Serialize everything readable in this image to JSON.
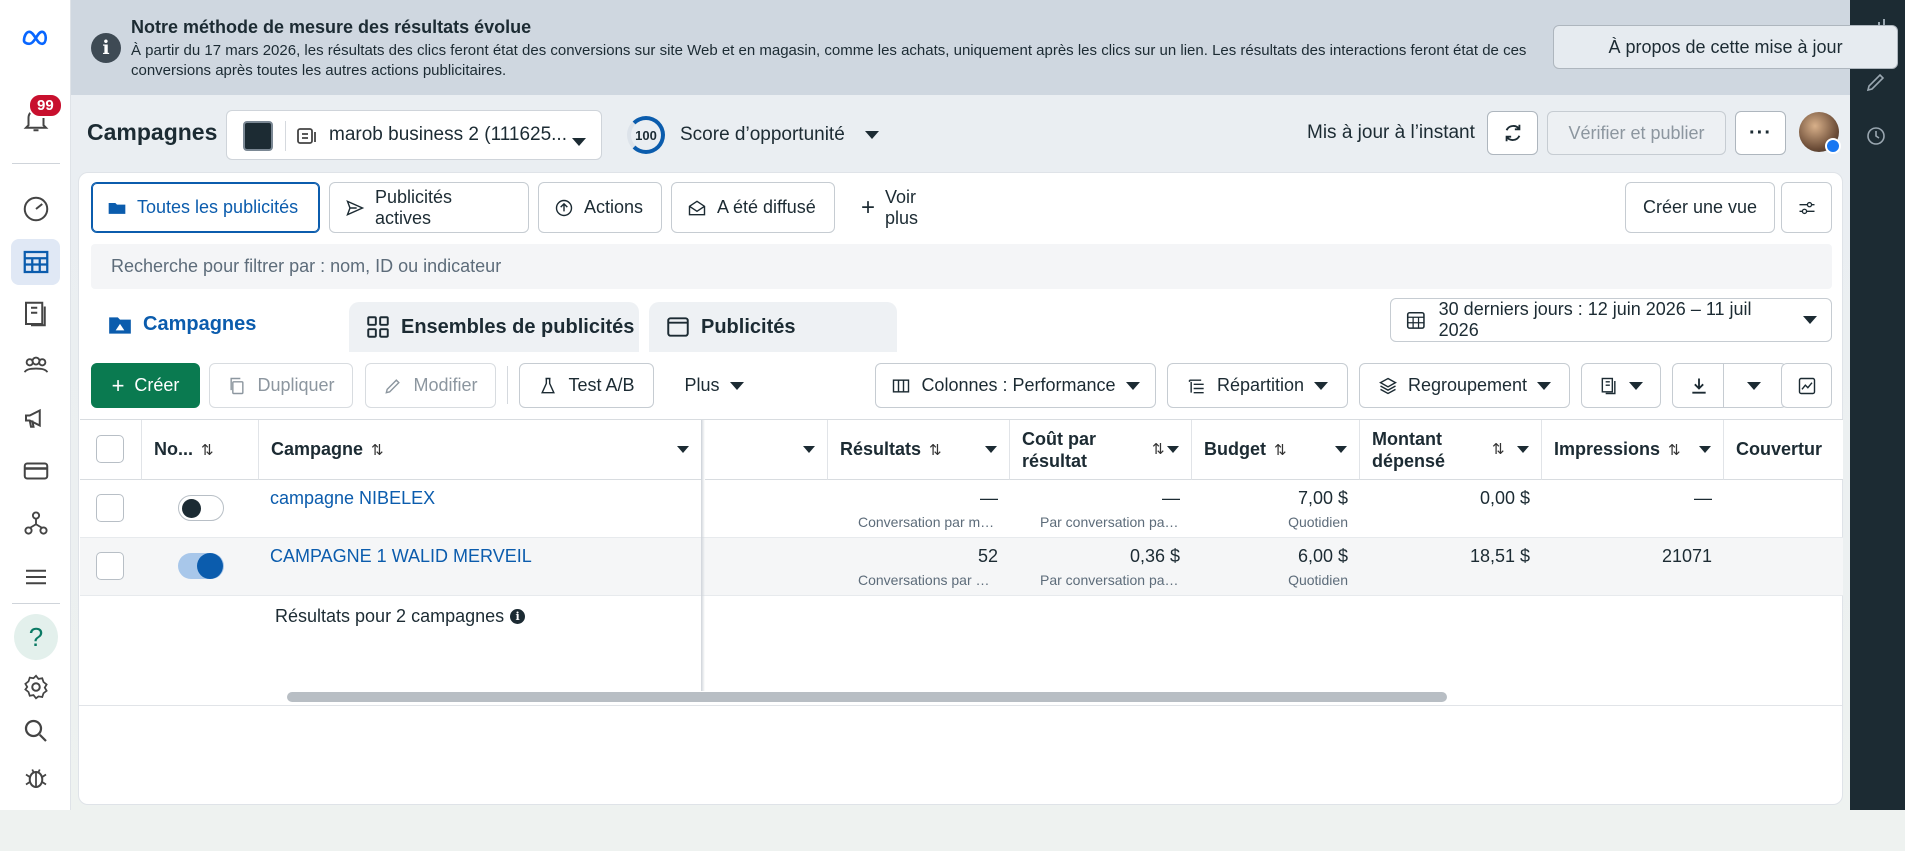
{
  "banner": {
    "title": "Notre méthode de mesure des résultats évolue",
    "text": "À partir du 17 mars 2026, les résultats des clics feront état des conversions sur site Web et en magasin, comme les achats, uniquement après les clics sur un lien. Les résultats des interactions feront état de ces conversions après toutes les autres actions publicitaires.",
    "button": "À propos de cette mise à jour"
  },
  "nav": {
    "notifications": "99"
  },
  "header": {
    "title": "Campagnes",
    "account": "marob business 2 (111625...",
    "score_value": "100",
    "score_label": "Score d’opportunité",
    "updated": "Mis à jour à l’instant",
    "publish": "Vérifier et publier",
    "more": "···"
  },
  "views": {
    "all": "Toutes les publicités",
    "active": "Publicités actives",
    "actions": "Actions",
    "delivered": "A été diffusé",
    "more": "Voir plus",
    "create_view": "Créer une vue"
  },
  "search": {
    "placeholder": "Recherche pour filtrer par : nom, ID ou indicateur"
  },
  "tabs": {
    "campaigns": "Campagnes",
    "adsets": "Ensembles de publicités",
    "ads": "Publicités"
  },
  "date_range": "30 derniers jours : 12 juin 2026 – 11 juil 2026",
  "toolbar": {
    "create": "Créer",
    "duplicate": "Dupliquer",
    "edit": "Modifier",
    "ab_test": "Test A/B",
    "more": "Plus",
    "columns": "Colonnes : Performance",
    "breakdown": "Répartition",
    "grouping": "Regroupement"
  },
  "table": {
    "headers": {
      "status": "No...",
      "campaign": "Campagne",
      "results": "Résultats",
      "cost_per_result": "Coût par résultat",
      "budget": "Budget",
      "spent": "Montant dépensé",
      "impressions": "Impressions",
      "reach": "Couvertur"
    },
    "rows": [
      {
        "name": "campagne NIBELEX",
        "on": false,
        "results": "—",
        "results_sub": "Conversation par messagerie démarrée",
        "cpr": "—",
        "cpr_sub": "Par conversation par messagerie démarrée",
        "budget": "7,00 $",
        "budget_sub": "Quotidien",
        "spent": "0,00 $",
        "impressions": "—"
      },
      {
        "name": "CAMPAGNE 1 WALID MERVEIL",
        "on": true,
        "results": "52",
        "results_sub": "Conversations par messagerie démarrées",
        "cpr": "0,36 $",
        "cpr_sub": "Par conversation par messagerie démarrée",
        "budget": "6,00 $",
        "budget_sub": "Quotidien",
        "spent": "18,51 $",
        "impressions": "21071"
      }
    ],
    "summary": "Résultats pour 2 campagnes"
  }
}
